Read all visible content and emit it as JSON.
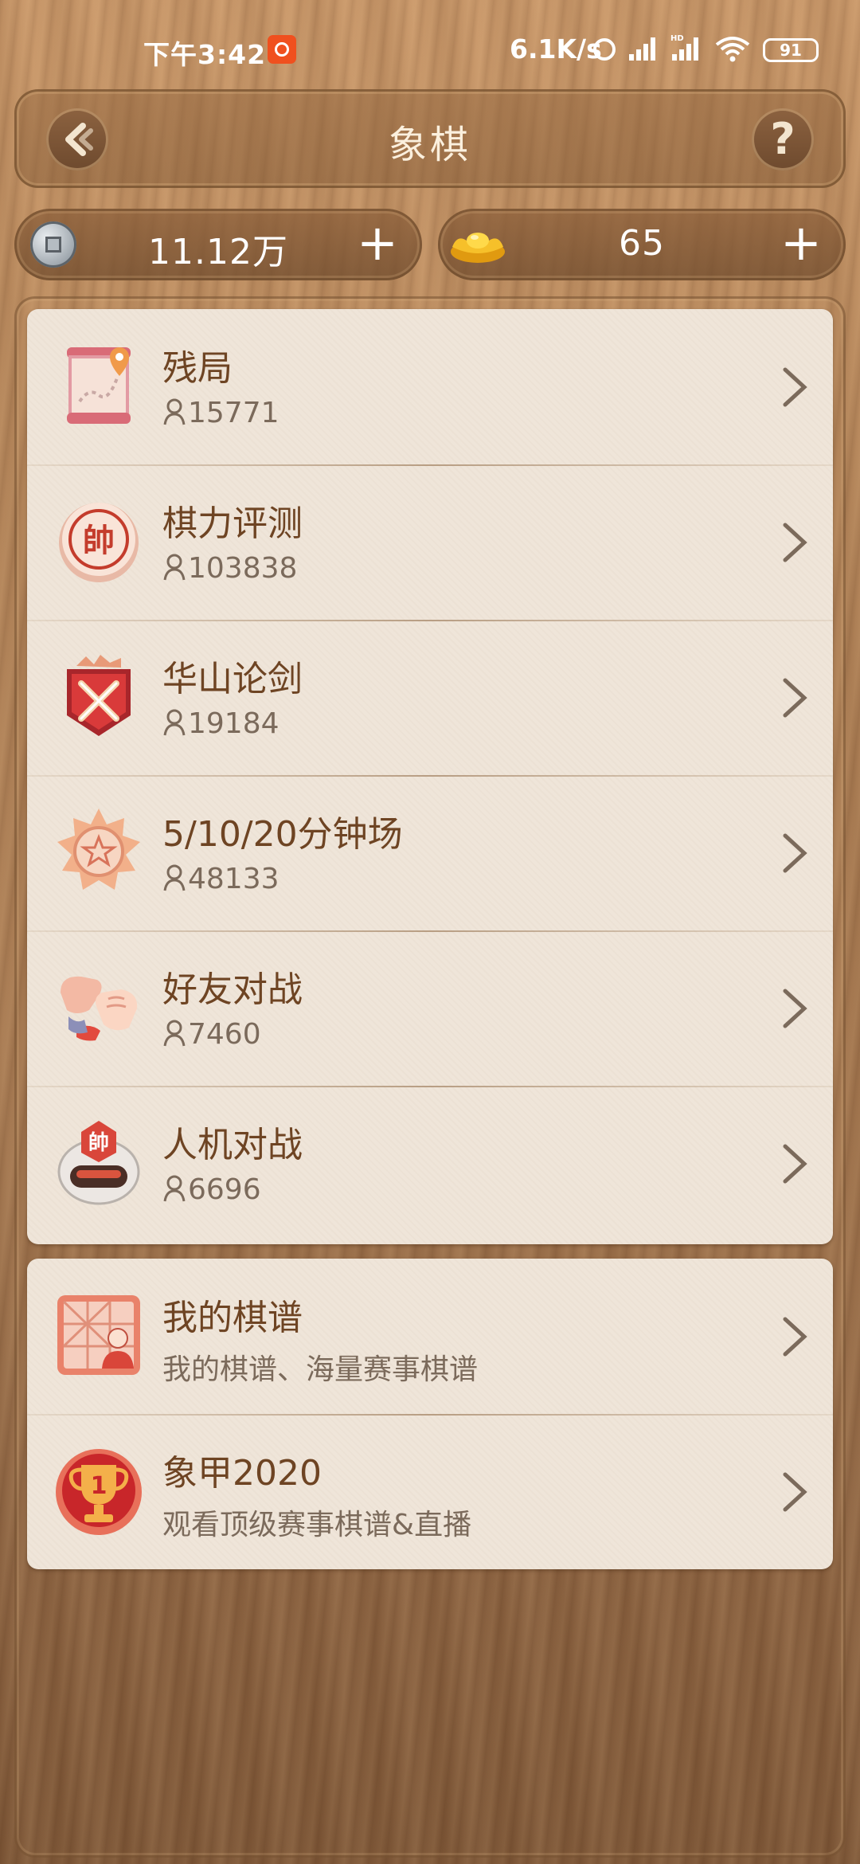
{
  "status_bar": {
    "time": "下午3:42",
    "net_speed": "6.1K/s",
    "battery": "91"
  },
  "header": {
    "title": "象棋"
  },
  "currency": {
    "coins": "11.12万",
    "ingots": "65",
    "plus_label": "+"
  },
  "modes": [
    {
      "label": "残局",
      "players": "15771",
      "icon": "scroll-map-icon"
    },
    {
      "label": "棋力评测",
      "players": "103838",
      "icon": "chess-piece-shuai-icon"
    },
    {
      "label": "华山论剑",
      "players": "19184",
      "icon": "crossed-swords-shield-icon"
    },
    {
      "label": "5/10/20分钟场",
      "players": "48133",
      "icon": "star-medal-icon"
    },
    {
      "label": "好友对战",
      "players": "7460",
      "icon": "fist-bump-icon"
    },
    {
      "label": "人机对战",
      "players": "6696",
      "icon": "robot-helmet-icon"
    }
  ],
  "records": [
    {
      "label": "我的棋谱",
      "desc": "我的棋谱、海量赛事棋谱",
      "icon": "chessboard-player-icon"
    },
    {
      "label": "象甲2020",
      "desc": "观看顶级赛事棋谱&直播",
      "icon": "trophy-icon"
    }
  ],
  "colors": {
    "card_bg": "#efe5d9",
    "label_text": "#6e4423",
    "sub_text": "#7b6a5b"
  }
}
